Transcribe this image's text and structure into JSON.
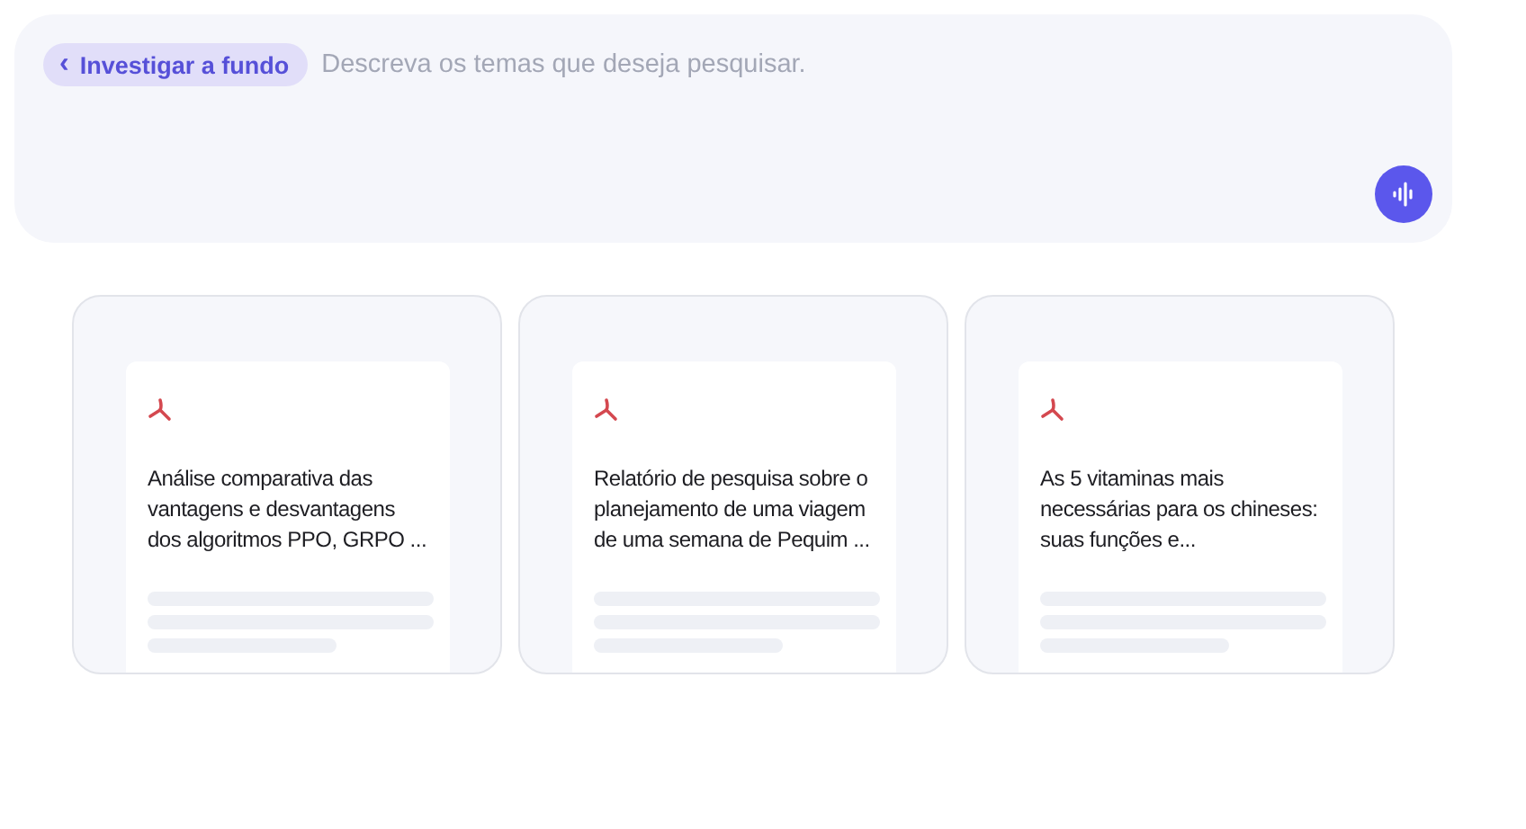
{
  "prompt": {
    "mode_chip": {
      "label": "Investigar a fundo",
      "icon": "‹"
    },
    "placeholder": "Descreva os temas que deseja pesquisar."
  },
  "cards": [
    {
      "kind": "pdf",
      "title": "Análise comparativa das vantagens e desvantagens dos algoritmos PPO, GRPO ..."
    },
    {
      "kind": "pdf",
      "title": "Relatório de pesquisa sobre o planejamento de uma viagem de uma semana de Pequim ..."
    },
    {
      "kind": "pdf",
      "title": "As 5 vitaminas mais necessárias para os chineses: suas funções e..."
    }
  ]
}
